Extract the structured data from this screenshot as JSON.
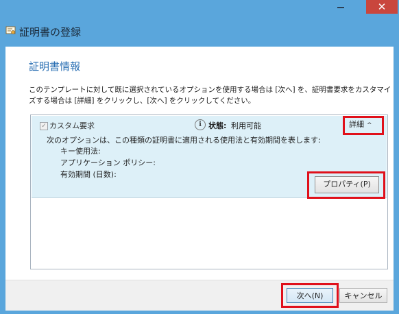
{
  "window": {
    "title": "証明書の登録",
    "close_glyph": "✕"
  },
  "page": {
    "heading": "証明書情報",
    "description": "このテンプレートに対して既に選択されているオプションを使用する場合は [次へ] を、証明書要求をカスタマイズする場合は [詳細] をクリックし、[次へ] をクリックしてください。"
  },
  "request_item": {
    "checkbox_mark": "✓",
    "title": "カスタム要求",
    "status_label": "状態:",
    "status_value": "利用可能",
    "details_label": "詳細",
    "details_chevron": "^",
    "description": "次のオプションは、この種類の証明書に適用される使用法と有効期間を表します:",
    "fields": [
      {
        "label": "キー使用法:"
      },
      {
        "label": "アプリケーション ポリシー:"
      },
      {
        "label": "有効期間 (日数):"
      }
    ],
    "properties_button": "プロパティ(P)"
  },
  "footer": {
    "next_button": "次へ(N)",
    "cancel_button": "キャンセル"
  },
  "colors": {
    "title_bar": "#5aa6dc",
    "close_button": "#c9463d",
    "heading": "#2a6fb3",
    "item_background": "#ddf0f8",
    "highlight_box": "#e0101a"
  },
  "icons": {
    "title": "certificate-icon",
    "info": "info-icon",
    "chevron": "chevron-up-icon"
  }
}
